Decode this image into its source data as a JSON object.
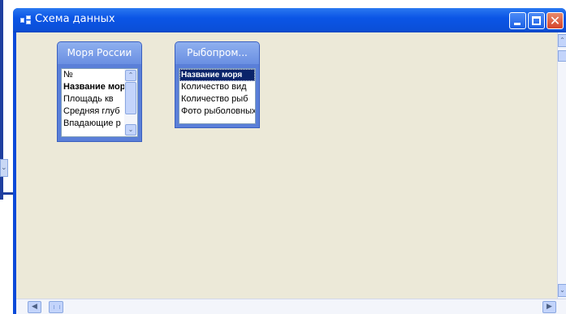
{
  "window": {
    "title": "Схема данных",
    "buttons": {
      "minimize_icon": "minimize-icon",
      "maximize_icon": "maximize-icon",
      "close_icon": "close-icon",
      "close_glyph": "✕"
    }
  },
  "tables": [
    {
      "title": "Моря России",
      "fields": [
        {
          "label": "№",
          "bold": false
        },
        {
          "label": "Название моря",
          "bold": true
        },
        {
          "label": "Площадь кв",
          "bold": false
        },
        {
          "label": "Средняя глуб",
          "bold": false
        },
        {
          "label": "Впадающие р",
          "bold": false
        }
      ],
      "has_scrollbar": true
    },
    {
      "title": "Рыбопром...",
      "fields": [
        {
          "label": "Название моря",
          "selected": true
        },
        {
          "label": "Количество вид"
        },
        {
          "label": "Количество рыб"
        },
        {
          "label": "Фото рыболовных"
        }
      ],
      "has_scrollbar": false
    }
  ],
  "scrollbars": {
    "up_glyph": "⌃",
    "down_glyph": "⌄",
    "left_glyph": "◀",
    "right_glyph": "▶",
    "small_up": "⌃",
    "small_down": "⌄"
  },
  "colors": {
    "titlebar": "#0b55e6",
    "client": "#ece9d8",
    "table_header": "#6a8fe2",
    "selection": "#0a246a"
  }
}
